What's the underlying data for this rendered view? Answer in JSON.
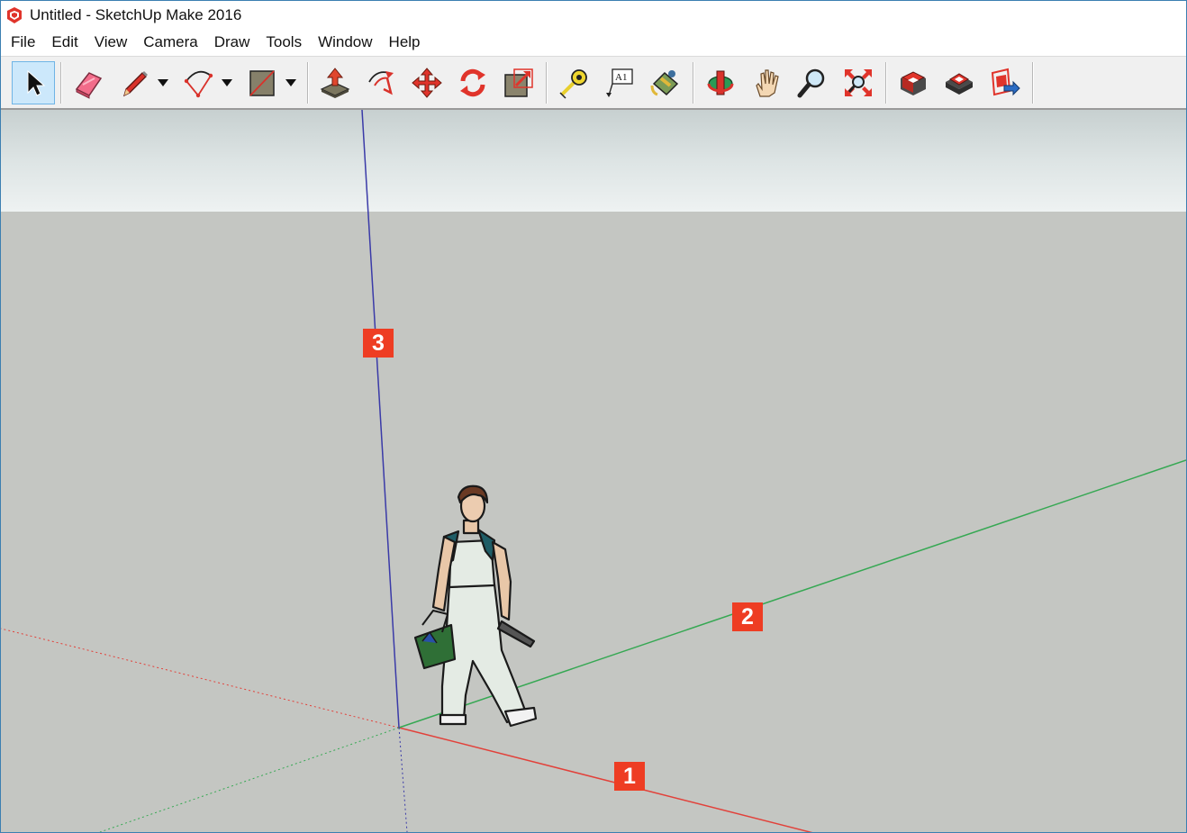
{
  "window": {
    "title": "Untitled - SketchUp Make 2016"
  },
  "menu": {
    "items": [
      {
        "label": "File"
      },
      {
        "label": "Edit"
      },
      {
        "label": "View"
      },
      {
        "label": "Camera"
      },
      {
        "label": "Draw"
      },
      {
        "label": "Tools"
      },
      {
        "label": "Window"
      },
      {
        "label": "Help"
      }
    ]
  },
  "toolbar": {
    "tools": [
      "select-tool",
      "eraser-tool",
      "line-tool",
      "arc-tool",
      "rectangle-tool",
      "push-pull-tool",
      "offset-tool",
      "move-tool",
      "rotate-tool",
      "scale-tool",
      "tape-measure-tool",
      "text-tool",
      "paint-bucket-tool",
      "orbit-tool",
      "pan-tool",
      "zoom-tool",
      "zoom-extents-tool",
      "3d-warehouse-tool",
      "extension-warehouse-tool",
      "share-model-tool"
    ],
    "active_tool": "select-tool",
    "tool_text": "A1"
  },
  "viewport": {
    "axis_labels": {
      "red": "1",
      "green": "2",
      "blue": "3"
    },
    "colors": {
      "sky": "#e6ecec",
      "ground": "#c4c6c2",
      "red_axis": "#e2413a",
      "green_axis": "#36a853",
      "blue_axis": "#3a3aa8",
      "label_bg": "#ee3d23"
    }
  }
}
